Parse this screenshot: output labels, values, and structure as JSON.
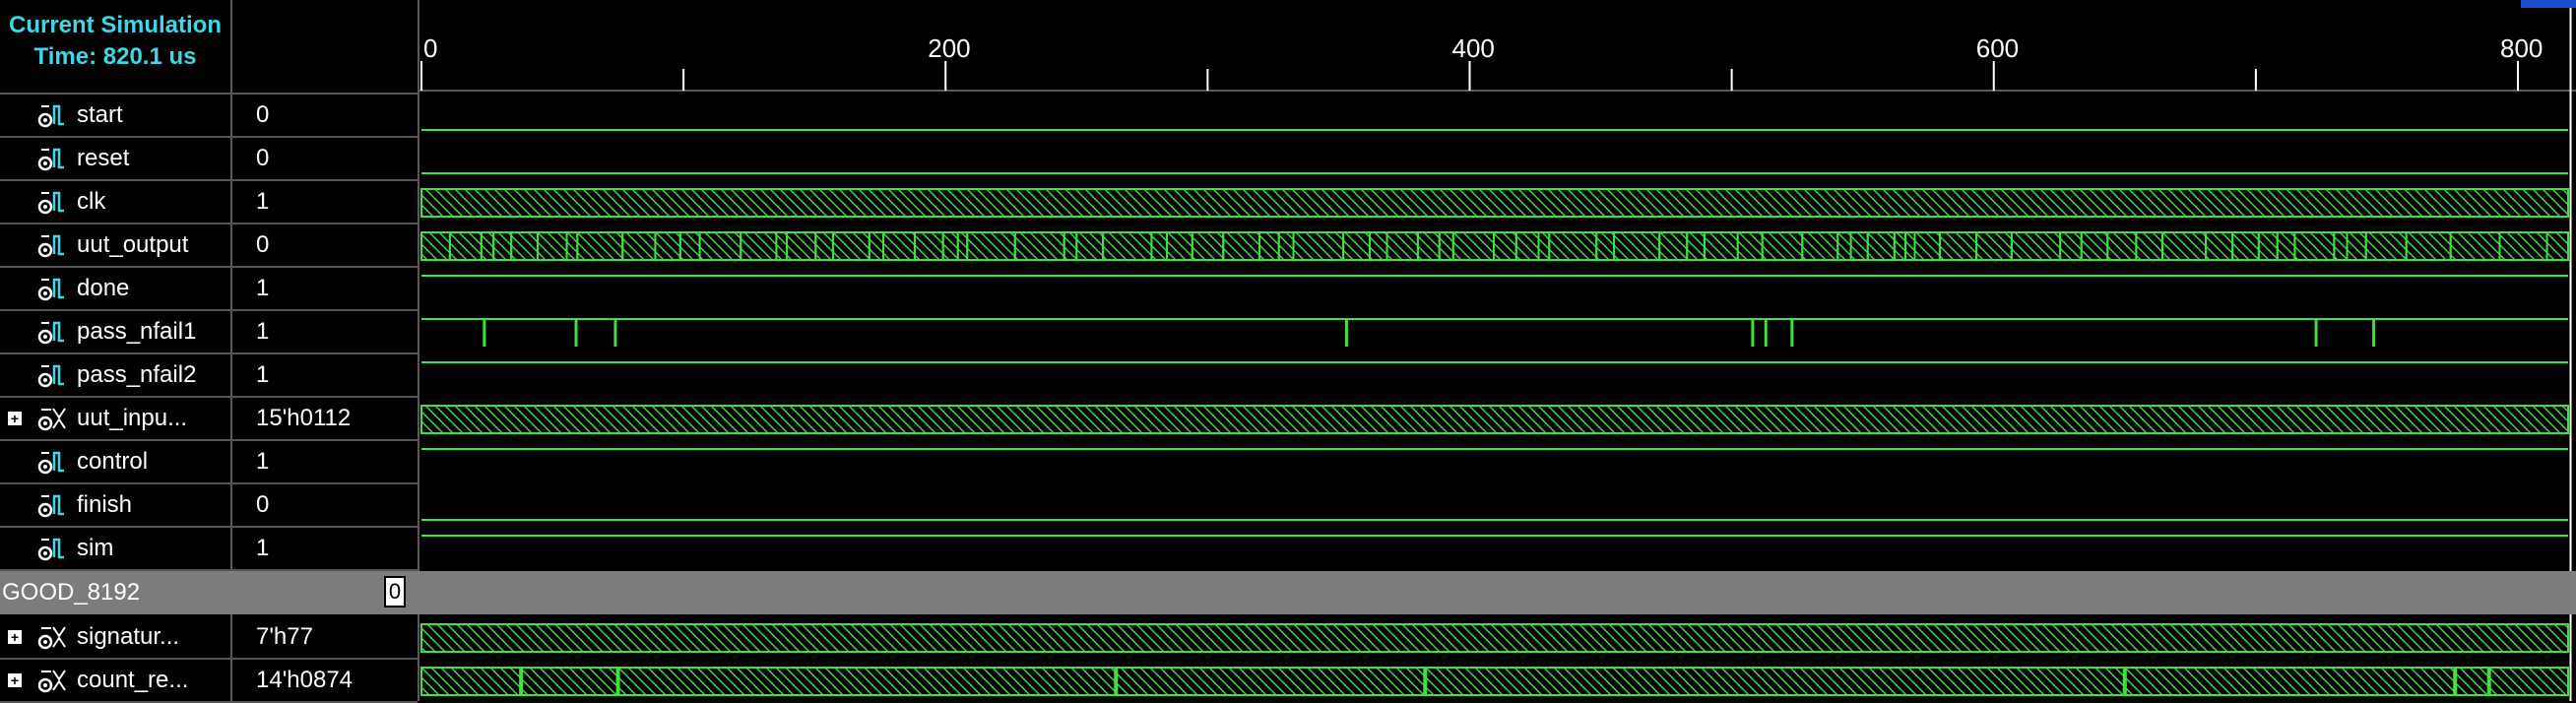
{
  "header": {
    "title_line1": "Current Simulation",
    "title_line2": "Time: 820.1 us"
  },
  "timeline": {
    "ticks": [
      {
        "time": 0,
        "label": "0"
      },
      {
        "time": 100,
        "label": ""
      },
      {
        "time": 200,
        "label": "200"
      },
      {
        "time": 300,
        "label": ""
      },
      {
        "time": 400,
        "label": "400"
      },
      {
        "time": 500,
        "label": ""
      },
      {
        "time": 600,
        "label": "600"
      },
      {
        "time": 700,
        "label": ""
      },
      {
        "time": 800,
        "label": "800"
      }
    ],
    "max_time": 820.1
  },
  "signals": [
    {
      "name": "start",
      "value": "0",
      "bus": false,
      "kind": "flat"
    },
    {
      "name": "reset",
      "value": "0",
      "bus": false,
      "kind": "flat"
    },
    {
      "name": "clk",
      "value": "1",
      "bus": false,
      "kind": "hatch"
    },
    {
      "name": "uut_output",
      "value": "0",
      "bus": false,
      "kind": "toggle"
    },
    {
      "name": "done",
      "value": "1",
      "bus": false,
      "kind": "high"
    },
    {
      "name": "pass_nfail1",
      "value": "1",
      "bus": false,
      "kind": "pulses"
    },
    {
      "name": "pass_nfail2",
      "value": "1",
      "bus": false,
      "kind": "high"
    },
    {
      "name": "uut_inpu...",
      "value": "15'h0112",
      "bus": true,
      "kind": "hatch"
    },
    {
      "name": "control",
      "value": "1",
      "bus": false,
      "kind": "high"
    },
    {
      "name": "finish",
      "value": "0",
      "bus": false,
      "kind": "flat"
    },
    {
      "name": "sim",
      "value": "1",
      "bus": false,
      "kind": "high"
    }
  ],
  "divider": {
    "label": "GOOD_8192",
    "value": "0"
  },
  "group_signals": [
    {
      "name": "signatur...",
      "value": "7'h77",
      "bus": true,
      "kind": "hatch"
    },
    {
      "name": "count_re...",
      "value": "14'h0874",
      "bus": true,
      "kind": "bus-segments"
    }
  ],
  "icons": {
    "signal": "signal-waveform-icon",
    "bus": "bus-waveform-icon",
    "expand": "expand-plus-icon"
  },
  "colors": {
    "wave": "#3fe03f",
    "title": "#3fd6e6",
    "divider": "#7c7c7c",
    "background": "#000000"
  }
}
